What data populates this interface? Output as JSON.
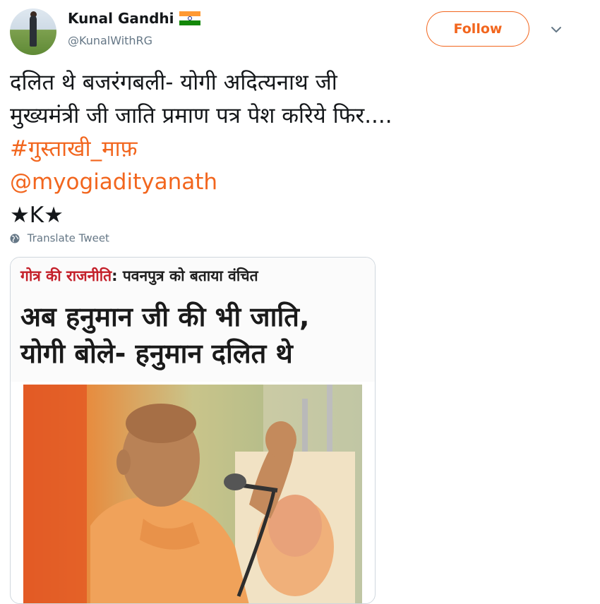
{
  "user": {
    "display_name": "Kunal Gandhi",
    "handle": "@KunalWithRG"
  },
  "follow_button": {
    "label": "Follow"
  },
  "tweet": {
    "line1": "दलित थे बजरंगबली- योगी अदित्यनाथ जी",
    "line2": "मुख्यमंत्री जी जाति प्रमाण पत्र पेश करिये फिर....",
    "hashtag": "#गुस्ताखी_माफ़",
    "mention": "@myogiadityanath",
    "signature": "★K★"
  },
  "translate_label": "Translate Tweet",
  "media": {
    "kicker_red": "गोत्र की राजनीति",
    "kicker_rest": ": पवनपुत्र को बताया वंचित",
    "headline_line1": "अब हनुमान जी की भी जाति,",
    "headline_line2": "योगी बोले- हनुमान दलित थे"
  },
  "colors": {
    "accent": "#f2661e",
    "flag_saffron": "#ff9933",
    "flag_green": "#138808",
    "kicker_red": "#c4202a"
  },
  "icons": [
    "india-flag-icon",
    "chevron-down-icon",
    "globe-icon"
  ]
}
